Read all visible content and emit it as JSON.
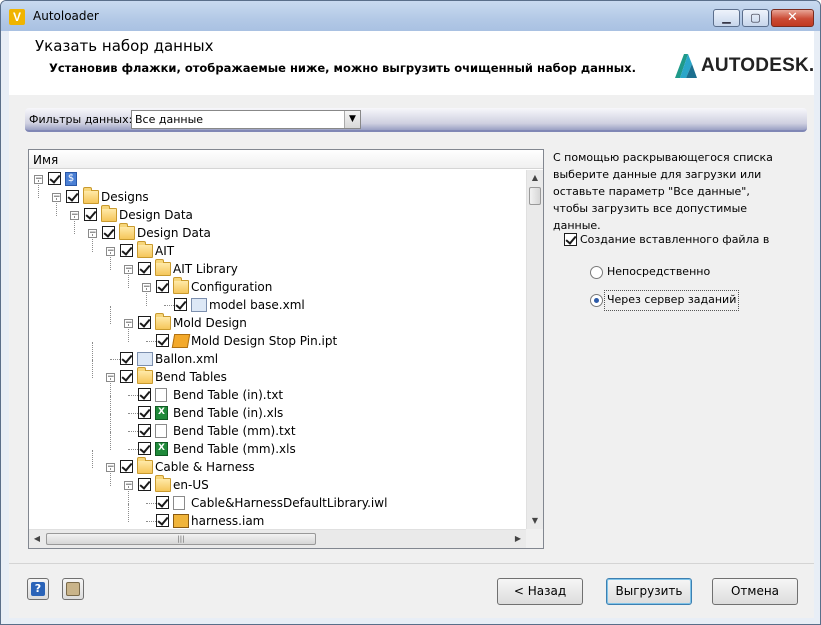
{
  "window": {
    "title": "Autoloader",
    "icon_letter": "V"
  },
  "header": {
    "title": "Указать набор данных",
    "subtitle": "Установив флажки, отображаемые ниже, можно выгрузить очищенный набор данных.",
    "brand": "AUTODESK."
  },
  "filter": {
    "label": "Фильтры данных:",
    "value": "Все данные"
  },
  "tree": {
    "column_header": "Имя",
    "items": [
      {
        "label": "$",
        "icon": "root-icon",
        "depth": 0,
        "expander": "−"
      },
      {
        "label": "Designs",
        "icon": "folder-icon",
        "depth": 1,
        "expander": "−"
      },
      {
        "label": "Design Data",
        "icon": "folder-icon",
        "depth": 2,
        "expander": "−"
      },
      {
        "label": "Design Data",
        "icon": "folder-icon",
        "depth": 3,
        "expander": "−"
      },
      {
        "label": "AIT",
        "icon": "folder-icon",
        "depth": 4,
        "expander": "−"
      },
      {
        "label": "AIT Library",
        "icon": "folder-icon",
        "depth": 5,
        "expander": "−"
      },
      {
        "label": "Configuration",
        "icon": "folder-icon",
        "depth": 6,
        "expander": "−"
      },
      {
        "label": "model base.xml",
        "icon": "xml-file-icon",
        "depth": 7,
        "expander": ""
      },
      {
        "label": "Mold Design",
        "icon": "folder-icon",
        "depth": 5,
        "expander": "−"
      },
      {
        "label": "Mold Design Stop Pin.ipt",
        "icon": "part-file-icon",
        "depth": 6,
        "expander": ""
      },
      {
        "label": "Ballon.xml",
        "icon": "xml-file-icon",
        "depth": 4,
        "expander": ""
      },
      {
        "label": "Bend Tables",
        "icon": "folder-icon",
        "depth": 4,
        "expander": "−"
      },
      {
        "label": "Bend Table (in).txt",
        "icon": "text-file-icon",
        "depth": 5,
        "expander": ""
      },
      {
        "label": "Bend Table (in).xls",
        "icon": "excel-file-icon",
        "depth": 5,
        "expander": ""
      },
      {
        "label": "Bend Table (mm).txt",
        "icon": "text-file-icon",
        "depth": 5,
        "expander": ""
      },
      {
        "label": "Bend Table (mm).xls",
        "icon": "excel-file-icon",
        "depth": 5,
        "expander": ""
      },
      {
        "label": "Cable & Harness",
        "icon": "folder-icon",
        "depth": 4,
        "expander": "−"
      },
      {
        "label": "en-US",
        "icon": "folder-icon",
        "depth": 5,
        "expander": "−"
      },
      {
        "label": "Cable&HarnessDefaultLibrary.iwl",
        "icon": "text-file-icon",
        "depth": 6,
        "expander": ""
      },
      {
        "label": "harness.iam",
        "icon": "assembly-file-icon",
        "depth": 6,
        "expander": ""
      }
    ],
    "vscroll_fraction": 0.0
  },
  "side": {
    "description": "С помощью раскрывающегося списка выберите данные для загрузки или оставьте параметр \"Все данные\", чтобы загрузить все допустимые данные.",
    "embed_checkbox_label": "Создание вставленного файла визуализации",
    "embed_checked": true,
    "radio_direct": "Непосредственно",
    "radio_job_server": "Через сервер заданий",
    "selected_radio": "job_server"
  },
  "footer": {
    "back": "< Назад",
    "upload": "Выгрузить",
    "cancel": "Отмена",
    "help_icon": "help-icon",
    "clipboard_icon": "clipboard-icon"
  }
}
